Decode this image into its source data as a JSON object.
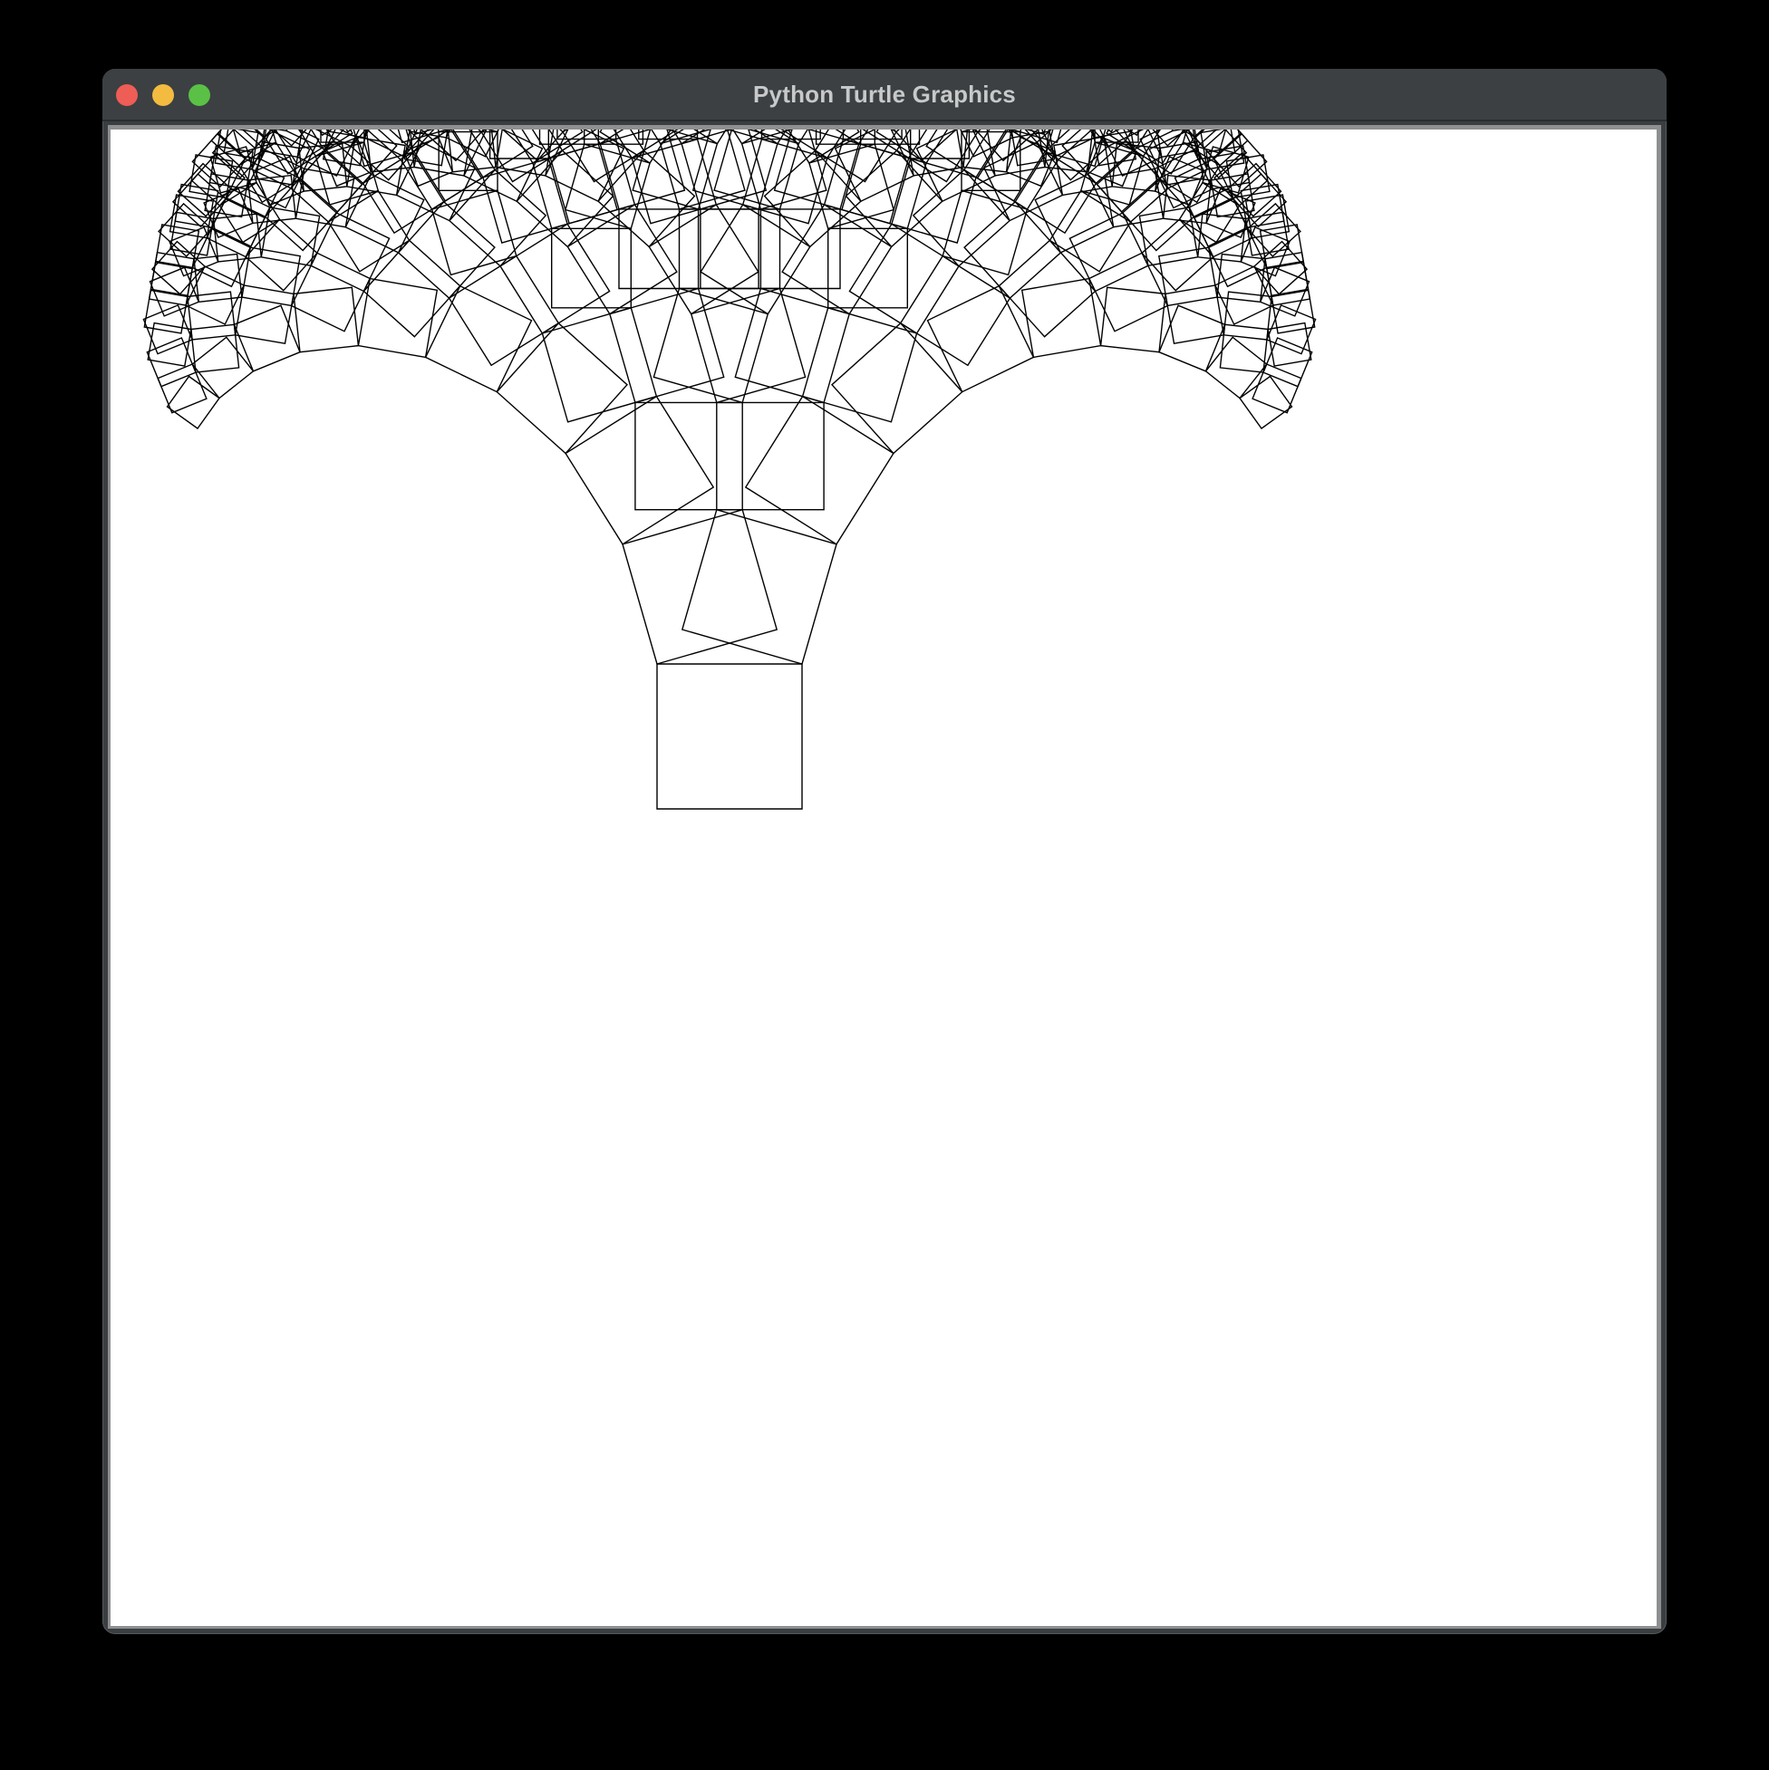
{
  "window": {
    "title": "Python Turtle Graphics",
    "controls": [
      "close-button",
      "minimize-button",
      "maximize-button"
    ]
  },
  "canvas": {
    "background": "#ffffff",
    "stroke_color": "#000000",
    "drawing": "recursive square fractal tree (Pythagoras-style) fanning upward"
  },
  "colors": {
    "desktop": "#000000",
    "titlebar": "#3c4042",
    "close": "#ee5d56",
    "minimize": "#f3bb3f",
    "maximize": "#5ac146",
    "title_text": "#c7c9ca"
  }
}
